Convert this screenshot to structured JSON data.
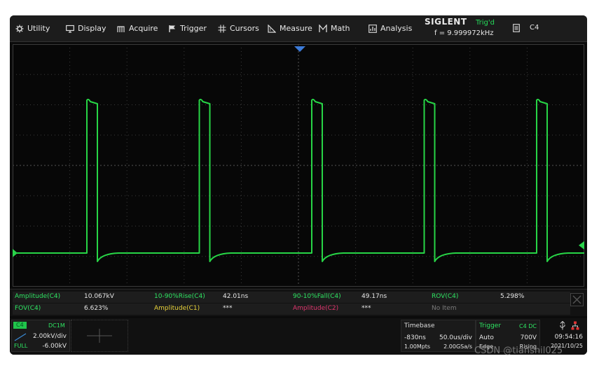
{
  "menu": [
    {
      "label": "Utility",
      "icon": "gear-icon"
    },
    {
      "label": "Display",
      "icon": "monitor-icon"
    },
    {
      "label": "Acquire",
      "icon": "acquire-icon"
    },
    {
      "label": "Trigger",
      "icon": "flag-icon"
    },
    {
      "label": "Cursors",
      "icon": "cursors-icon"
    },
    {
      "label": "Measure",
      "icon": "ruler-icon"
    },
    {
      "label": "Math",
      "icon": "math-icon"
    },
    {
      "label": "Analysis",
      "icon": "analysis-icon"
    }
  ],
  "brand": {
    "logo": "SIGLENT",
    "status": "Trig'd",
    "freq": "f = 9.999972kHz"
  },
  "header_channel": "C4",
  "trace": {
    "color": "#29e04a",
    "ground_color": "#29d34a"
  },
  "measurements": {
    "row1": [
      {
        "label": "Amplitude(C4)",
        "value": "10.067kV",
        "label_color": "#2ee462"
      },
      {
        "label": "10-90%Rise(C4)",
        "value": "42.01ns",
        "label_color": "#2ee462"
      },
      {
        "label": "90-10%Fall(C4)",
        "value": "49.17ns",
        "label_color": "#2ee462"
      },
      {
        "label": "ROV(C4)",
        "value": "5.298%",
        "label_color": "#2ee462"
      }
    ],
    "row2": [
      {
        "label": "FOV(C4)",
        "value": "6.623%",
        "label_color": "#2ee462"
      },
      {
        "label": "Amplitude(C1)",
        "value": "***",
        "label_color": "#e8d23a"
      },
      {
        "label": "Amplitude(C2)",
        "value": "***",
        "label_color": "#e0356e"
      },
      {
        "label": "No Item",
        "value": "",
        "label_color": "#7a7a7a"
      }
    ]
  },
  "channel": {
    "name": "C4",
    "coupling": "DC1M",
    "vdiv": "2.00kV/div",
    "mode": "FULL",
    "offset": "-6.00kV"
  },
  "timebase": {
    "title": "Timebase",
    "delay": "-830ns",
    "div": "50.0us/div",
    "mpts": "1.00Mpts",
    "rate": "2.00GSa/s"
  },
  "trigger": {
    "title": "Trigger",
    "source": "C4 DC",
    "mode": "Auto",
    "level": "700V",
    "type": "Edge",
    "slope": "Rising"
  },
  "system": {
    "time": "09:54:16",
    "date": "2021/10/25"
  },
  "watermark": "CSDN @tianshil025"
}
